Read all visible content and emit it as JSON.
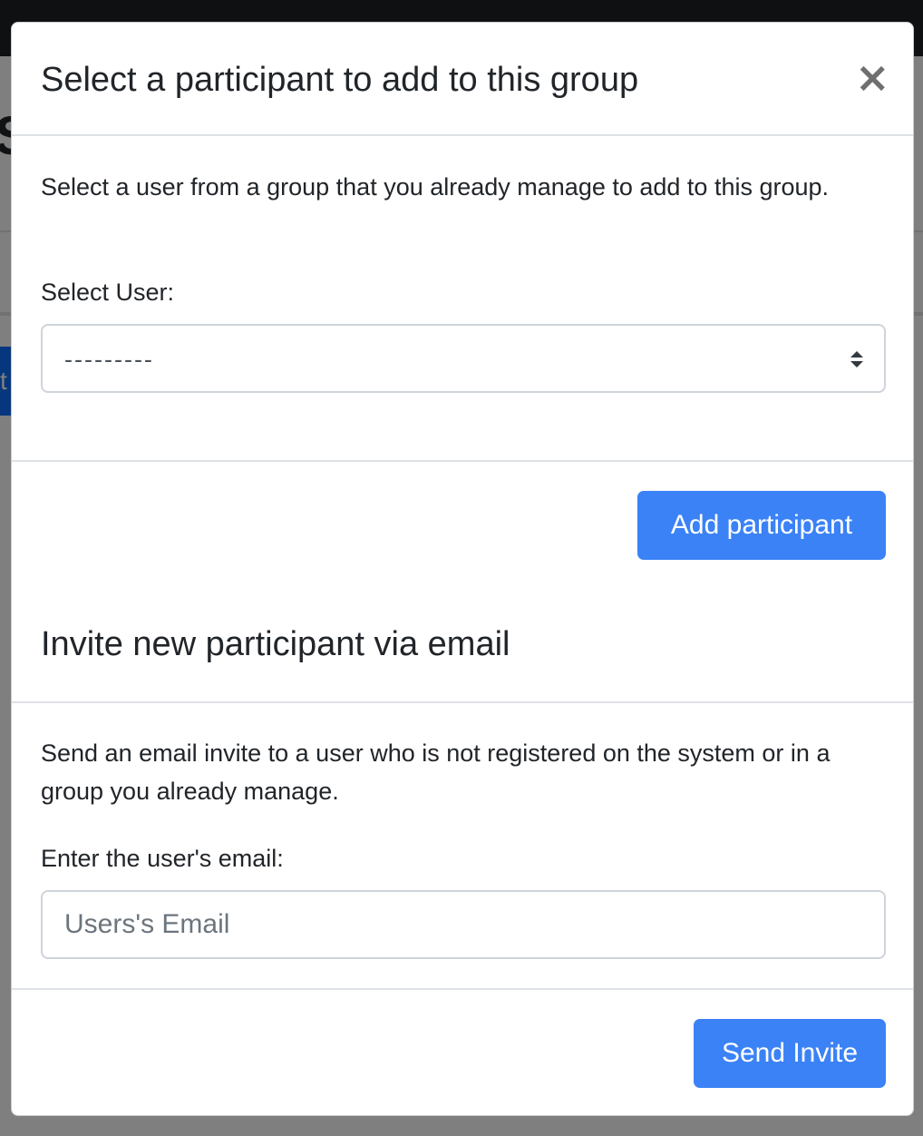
{
  "background": {
    "heading_fragment": "S",
    "button_fragment": "t"
  },
  "modal": {
    "title": "Select a participant to add to this group",
    "close_symbol": "×",
    "select_section": {
      "description": "Select a user from a group that you already manage to add to this group.",
      "label": "Select User:",
      "select_value": "---------",
      "button_label": "Add participant"
    },
    "invite_section": {
      "heading": "Invite new participant via email",
      "description": "Send an email invite to a user who is not registered on the system or in a group you already manage.",
      "label": "Enter the user's email:",
      "email_placeholder": "Users's Email",
      "email_value": "",
      "button_label": "Send Invite"
    }
  },
  "colors": {
    "primary_button": "#3b82f6",
    "backdrop": "rgba(0,0,0,0.5)",
    "top_bar": "#1f2024"
  }
}
